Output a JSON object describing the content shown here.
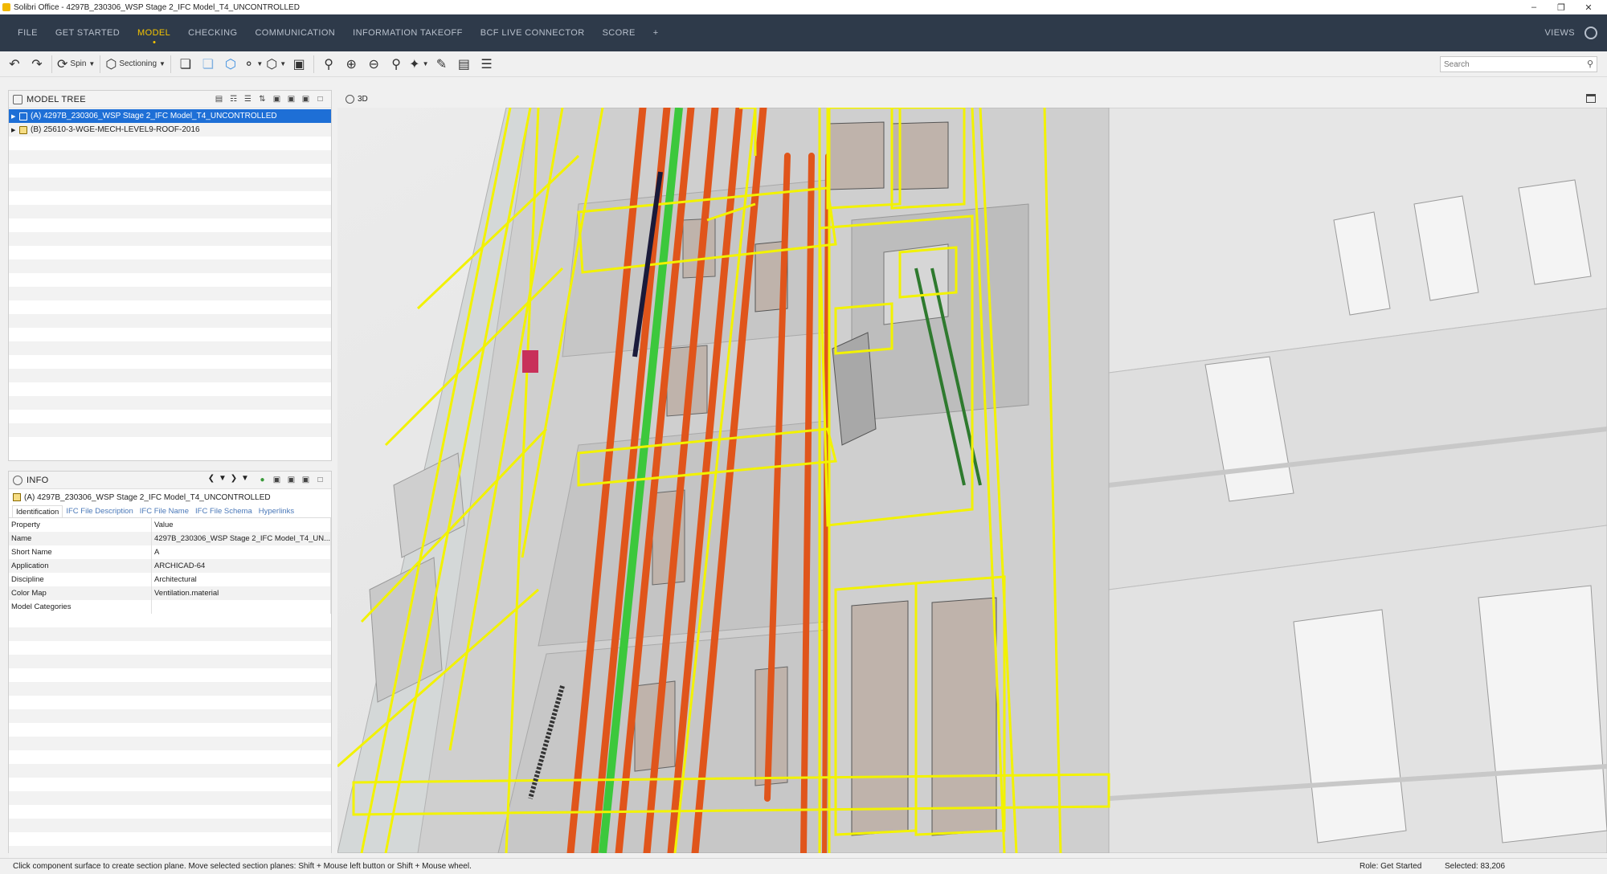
{
  "window": {
    "title": "Solibri Office - 4297B_230306_WSP Stage 2_IFC Model_T4_UNCONTROLLED",
    "minimize": "–",
    "maximize": "❐",
    "close": "✕"
  },
  "menu": {
    "items": [
      "FILE",
      "GET STARTED",
      "MODEL",
      "CHECKING",
      "COMMUNICATION",
      "INFORMATION TAKEOFF",
      "BCF LIVE CONNECTOR",
      "SCORE"
    ],
    "active": "MODEL",
    "add": "+",
    "views": "VIEWS"
  },
  "toolbar": {
    "spin_label": "Spin",
    "sectioning_label": "Sectioning",
    "search_placeholder": "Search"
  },
  "model_tree": {
    "title": "MODEL TREE",
    "rows": [
      {
        "label": "(A) 4297B_230306_WSP Stage 2_IFC Model_T4_UNCONTROLLED",
        "selected": true
      },
      {
        "label": "(B) 25610-3-WGE-MECH-LEVEL9-ROOF-2016",
        "selected": false
      }
    ]
  },
  "info": {
    "title": "INFO",
    "file": "(A) 4297B_230306_WSP Stage 2_IFC Model_T4_UNCONTROLLED",
    "tabs": [
      "Identification",
      "IFC File Description",
      "IFC File Name",
      "IFC File Schema",
      "Hyperlinks"
    ],
    "active_tab": "Identification",
    "columns": [
      "Property",
      "Value"
    ],
    "rows": [
      [
        "Name",
        "4297B_230306_WSP Stage 2_IFC Model_T4_UN..."
      ],
      [
        "Short Name",
        "A"
      ],
      [
        "Application",
        "ARCHICAD-64"
      ],
      [
        "Discipline",
        "Architectural"
      ],
      [
        "Color Map",
        "Ventilation.material"
      ],
      [
        "Model Categories",
        ""
      ]
    ]
  },
  "view3d": {
    "title": "3D",
    "colors": {
      "highlight": "#f2f200",
      "pipe": "#e0551b",
      "pipe_green": "#3cc83c",
      "wall": "#d8d8d8",
      "panel": "#bfb3ab"
    }
  },
  "status": {
    "hint": "Click component surface to create section plane. Move selected section planes: Shift + Mouse left button or Shift + Mouse wheel.",
    "role": "Role: Get Started",
    "selected": "Selected: 83,206"
  }
}
